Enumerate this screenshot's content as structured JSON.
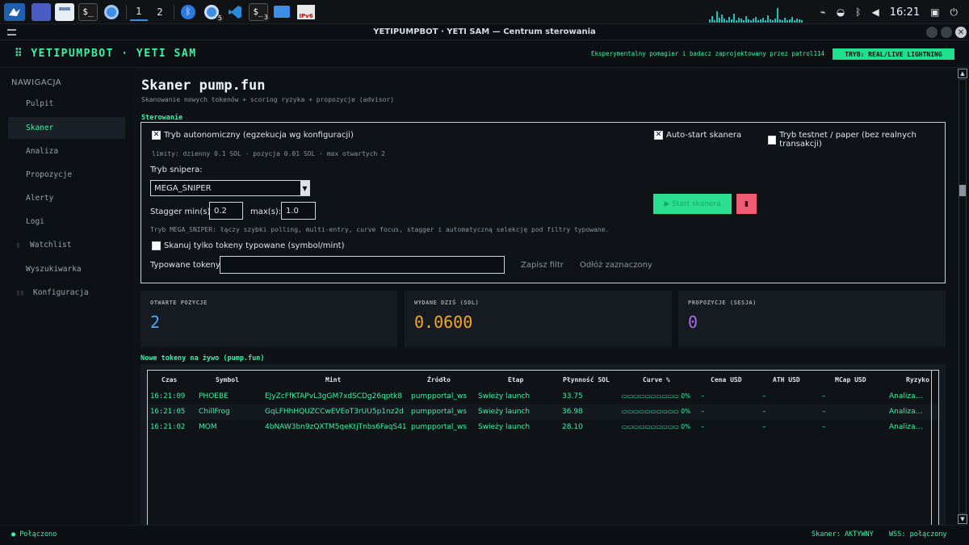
{
  "taskbar": {
    "workspaces": [
      "1",
      "2"
    ],
    "clock": "16:21",
    "badges": [
      "5",
      "3"
    ],
    "ipv6": "IPv6",
    "icons": [
      "app-menu-icon",
      "desktop-icon",
      "file-manager-icon",
      "terminal-icon",
      "chromium-icon",
      "bluetooth-icon",
      "chrome-icon",
      "vscode-icon",
      "terminal-icon",
      "folder-icon",
      "network-icon",
      "clip-icon",
      "wifi-icon",
      "bluetooth-icon",
      "volume-icon",
      "lock-icon",
      "power-icon"
    ]
  },
  "window": {
    "title": "YETIPUMPBOT · YETI SAM — Centrum sterowania",
    "close_glyph": "✕"
  },
  "header": {
    "brand": "⠿ YETIPUMPBOT · YETI SAM",
    "subtitle": "Eksperymentalny pomagier i badacz zaprojektowany przez patrol114",
    "mode_badge": "TRYB: REAL/LIVE LIGHTNING"
  },
  "sidebar": {
    "title": "NAWIGACJA",
    "items": [
      {
        "label": "Pulpit",
        "prefix": ""
      },
      {
        "label": "Skaner",
        "prefix": ""
      },
      {
        "label": "Analiza",
        "prefix": ""
      },
      {
        "label": "Propozycje",
        "prefix": ""
      },
      {
        "label": "Alerty",
        "prefix": ""
      },
      {
        "label": "Logi",
        "prefix": ""
      },
      {
        "label": "Watchlist",
        "prefix": "▯"
      },
      {
        "label": "Wyszukiwarka",
        "prefix": ""
      },
      {
        "label": "Konfiguracja",
        "prefix": "▯▯"
      }
    ],
    "active_index": 1
  },
  "page": {
    "title": "Skaner pump.fun",
    "subtitle": "Skanowanie nowych tokenów + scoring ryzyka + propozycje (advisor)"
  },
  "controls": {
    "section": "Sterowanie",
    "autonomous": {
      "label": "Tryb autonomiczny (egzekucja wg konfiguracji)",
      "checked": true
    },
    "limits": "limity: dzienny 0.1 SOL · pozycja 0.01 SOL · max otwartych 2",
    "auto_start": {
      "label": "Auto-start skanera",
      "checked": true
    },
    "testnet": {
      "label": "Tryb testnet / paper (bez realnych transakcji)",
      "checked": false
    },
    "sniper_label": "Tryb snipera:",
    "sniper_value": "MEGA_SNIPER",
    "stagger_min_label": "Stagger min(s):",
    "stagger_min": "0.2",
    "stagger_max_label": "max(s):",
    "stagger_max": "1.0",
    "sniper_desc": "Tryb MEGA_SNIPER: łączy szybki polling, multi-entry, curve focus, stagger i automatyczną selekcję pod filtry typowane.",
    "typed_only": {
      "label": "Skanuj tylko tokeny typowane (symbol/mint)",
      "checked": false
    },
    "typed_label": "Typowane tokeny:",
    "typed_value": "",
    "save_filter": "Zapisz filtr",
    "clear_selected": "Odłóż zaznaczony",
    "start_label": "▶ Start skanera",
    "stop_label": "▮"
  },
  "stats": [
    {
      "label": "OTWARTE POZYCJE",
      "value": "2",
      "color": "#4aa8ff"
    },
    {
      "label": "WYDANE DZIŚ (SOL)",
      "value": "0.0600",
      "color": "#f5a623"
    },
    {
      "label": "PROPOZYCJE (SESJA)",
      "value": "0",
      "color": "#a86cf0"
    }
  ],
  "live": {
    "section": "Nowe tokeny na żywo (pump.fun)",
    "columns": [
      "Czas",
      "Symbol",
      "Mint",
      "Źródło",
      "Etap",
      "Płynność SOL",
      "Curve %",
      "Cena USD",
      "ATH USD",
      "MCap USD",
      "Ryzyko"
    ],
    "rows": [
      {
        "czas": "16:21:09",
        "symbol": "PHOEBE",
        "mint": "EJyZcFfKTAPvL3gGM7xdSCDg26qptk8",
        "zrodlo": "pumpportal_ws",
        "etap": "Świeży launch",
        "plynnosc": "33.75",
        "curve": "▭▭▭▭▭▭▭▭▭▭ 0%",
        "cena": "–",
        "ath": "–",
        "mcap": "–",
        "ryzyko": "Analiza…"
      },
      {
        "czas": "16:21:05",
        "symbol": "ChillFrog",
        "mint": "GqLFHhHQUZCCwEVEoT3rUU5p1nz2d",
        "zrodlo": "pumpportal_ws",
        "etap": "Świeży launch",
        "plynnosc": "36.98",
        "curve": "▭▭▭▭▭▭▭▭▭▭ 0%",
        "cena": "–",
        "ath": "–",
        "mcap": "–",
        "ryzyko": "Analiza…"
      },
      {
        "czas": "16:21:02",
        "symbol": "MOM",
        "mint": "4bNAW3bn9zQXTM5qeKtjTnbs6FaqS41",
        "zrodlo": "pumpportal_ws",
        "etap": "Świeży launch",
        "plynnosc": "28.10",
        "curve": "▭▭▭▭▭▭▭▭▭▭ 0%",
        "cena": "–",
        "ath": "–",
        "mcap": "–",
        "ryzyko": "Analiza…"
      }
    ]
  },
  "statusbar": {
    "left": "● Połączono",
    "scanner": "Skaner: AKTYWNY",
    "wss": "WSS: połączony"
  },
  "colors": {
    "accent": "#39f3a3",
    "start_button": "#2adf8e",
    "stop_button": "#ee5c71"
  }
}
